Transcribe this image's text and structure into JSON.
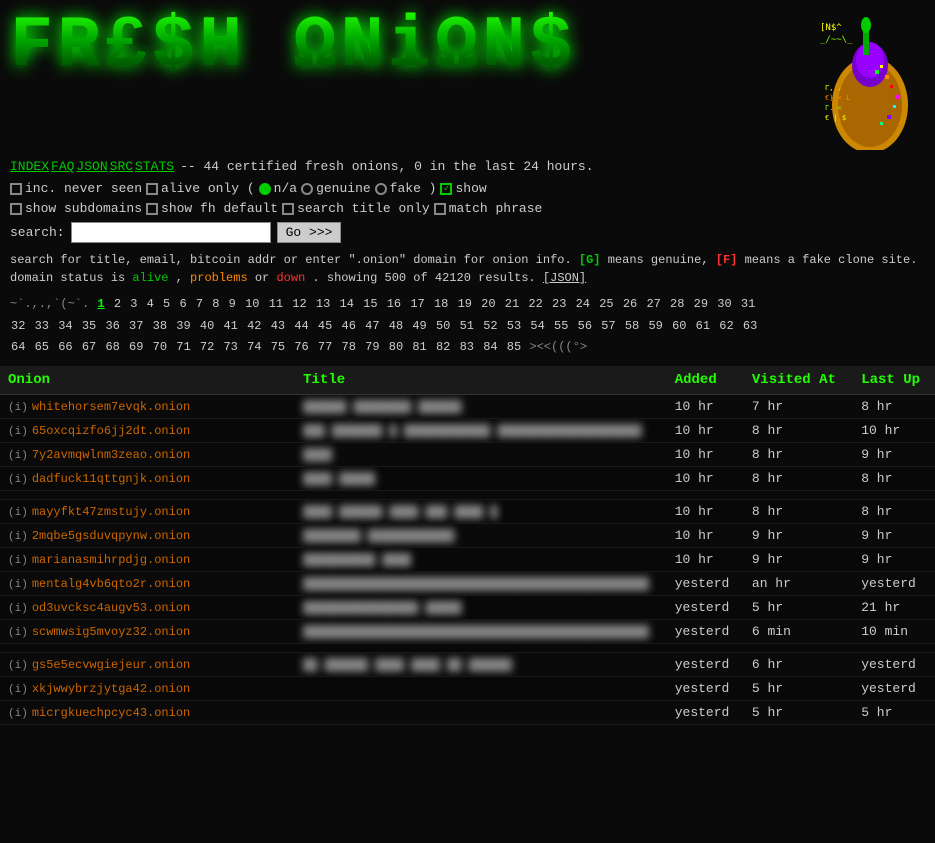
{
  "logo": {
    "text": "FR£$H ΩNiΩN$",
    "display": "FRESH ONIONS"
  },
  "navbar": {
    "links": [
      "INDEX",
      "FAQ",
      "JSON",
      "SRC",
      "STATS"
    ],
    "info": "-- 44 certified fresh onions, 0 in the last 24 hours."
  },
  "options": {
    "inc_never_seen": {
      "label": "inc. never seen",
      "checked": false
    },
    "alive_only": {
      "label": "alive only (",
      "checked": false
    },
    "na": {
      "label": "n/a",
      "type": "radio",
      "filled": true
    },
    "genuine": {
      "label": "genuine",
      "type": "radio",
      "filled": false
    },
    "fake": {
      "label": "fake )",
      "type": "radio",
      "filled": false
    },
    "show": {
      "label": "show",
      "checked": true
    },
    "show_subdomains": {
      "label": "show subdomains",
      "checked": false
    },
    "show_fh_default": {
      "label": "show fh default",
      "checked": false
    },
    "search_title_only": {
      "label": "search title only",
      "checked": false
    },
    "match_phrase": {
      "label": "match phrase",
      "checked": false
    }
  },
  "search": {
    "label": "search:",
    "placeholder": "",
    "value": "",
    "button": "Go >>>"
  },
  "info": {
    "line1": "search for title, email, bitcoin addr or enter \".onion\" domain for onion info.",
    "genuine_badge": "[G]",
    "genuine_desc": "means genuine,",
    "fake_badge": "[F]",
    "fake_desc": "means a fake clone site. domain status is",
    "alive": "alive",
    "problems": "problems",
    "or": "or",
    "down": "down",
    "showing": ". showing 500 of 42120 results.",
    "json_link": "[JSON]"
  },
  "pagination": {
    "special": "~`.,.,`(~`.",
    "current": "1",
    "pages": [
      "2",
      "3",
      "4",
      "5",
      "6",
      "7",
      "8",
      "9",
      "10",
      "11",
      "12",
      "13",
      "14",
      "15",
      "16",
      "17",
      "18",
      "19",
      "20",
      "21",
      "22",
      "23",
      "24",
      "25",
      "26",
      "27",
      "28",
      "29",
      "30",
      "31",
      "32",
      "33",
      "34",
      "35",
      "36",
      "37",
      "38",
      "39",
      "40",
      "41",
      "42",
      "43",
      "44",
      "45",
      "46",
      "47",
      "48",
      "49",
      "50",
      "51",
      "52",
      "53",
      "54",
      "55",
      "56",
      "57",
      "58",
      "59",
      "60",
      "61",
      "62",
      "63",
      "64",
      "65",
      "66",
      "67",
      "68",
      "69",
      "70",
      "71",
      "72",
      "73",
      "74",
      "75",
      "76",
      "77",
      "78",
      "79",
      "80",
      "81",
      "82",
      "83",
      "84",
      "85"
    ],
    "end": "><<(((°>"
  },
  "table": {
    "headers": [
      "Onion",
      "Title",
      "Added",
      "Visited At",
      "Last Up"
    ],
    "rows": [
      {
        "onion": "whitehorsem7evqk.onion",
        "title_blurred": true,
        "title": "██████ ████████ ██████",
        "added": "10 hr",
        "visited": "7 hr",
        "last_up": "8 hr",
        "gap": false
      },
      {
        "onion": "65oxcqizfo6jj2dt.onion",
        "title_blurred": true,
        "title": "███ ███████ █ ████████████ ████████████████████",
        "added": "10 hr",
        "visited": "8 hr",
        "last_up": "10 hr",
        "gap": false
      },
      {
        "onion": "7y2avmqwlnm3zeao.onion",
        "title_blurred": true,
        "title": "████",
        "added": "10 hr",
        "visited": "8 hr",
        "last_up": "9 hr",
        "gap": false
      },
      {
        "onion": "dadfuck11qttgnjk.onion",
        "title_blurred": true,
        "title": "████ █████",
        "added": "10 hr",
        "visited": "8 hr",
        "last_up": "8 hr",
        "gap": false
      },
      {
        "onion": "mayyfkt47zmstujy.onion",
        "title_blurred": true,
        "title": "████ ██████ ████ ███ ████ █",
        "added": "10 hr",
        "visited": "8 hr",
        "last_up": "8 hr",
        "gap": true
      },
      {
        "onion": "2mqbe5gsduvqpynw.onion",
        "title_blurred": true,
        "title": "████████ ████████████",
        "added": "10 hr",
        "visited": "9 hr",
        "last_up": "9 hr",
        "gap": false
      },
      {
        "onion": "marianasmihrpdjg.onion",
        "title_blurred": true,
        "title": "██████████ ████",
        "added": "10 hr",
        "visited": "9 hr",
        "last_up": "9 hr",
        "gap": false
      },
      {
        "onion": "mentalg4vb6qto2r.onion",
        "title_blurred": true,
        "title": "████████████████████████████████████████████████",
        "added": "yesterd",
        "visited": "an hr",
        "last_up": "yesterd",
        "gap": false
      },
      {
        "onion": "od3uvcksc4augv53.onion",
        "title_blurred": true,
        "title": "████████████████ █████",
        "added": "yesterd",
        "visited": "5 hr",
        "last_up": "21 hr",
        "gap": false
      },
      {
        "onion": "scwmwsig5mvoyz32.onion",
        "title_blurred": true,
        "title": "████████████████████████████████████████████████",
        "added": "yesterd",
        "visited": "6 min",
        "last_up": "10 min",
        "gap": false
      },
      {
        "onion": "gs5e5ecvwgiejeur.onion",
        "title_blurred": true,
        "title": "██ ██████ ████ ████ ██ ██████",
        "added": "yesterd",
        "visited": "6 hr",
        "last_up": "yesterd",
        "gap": true
      },
      {
        "onion": "xkjwwybrzjytga42.onion",
        "title_blurred": true,
        "title": "",
        "added": "yesterd",
        "visited": "5 hr",
        "last_up": "yesterd",
        "gap": false
      },
      {
        "onion": "micrgkuechpcyc43.onion",
        "title_blurred": true,
        "title": "",
        "added": "yesterd",
        "visited": "5 hr",
        "last_up": "5 hr",
        "gap": false
      }
    ]
  }
}
